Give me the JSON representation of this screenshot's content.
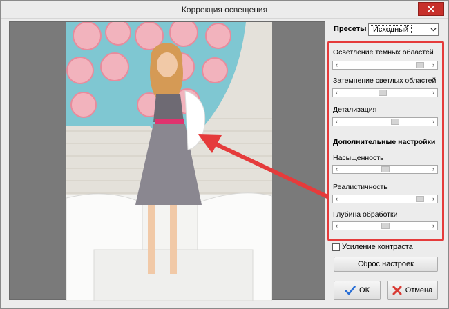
{
  "window": {
    "title": "Коррекция освещения",
    "close_icon": "close-icon"
  },
  "presets": {
    "label": "Пресеты",
    "selected": "Исходный"
  },
  "sliders": [
    {
      "label": "Осветление тёмных областей",
      "value": 0.93
    },
    {
      "label": "Затемнение светлых областей",
      "value": 0.47
    },
    {
      "label": "Детализация",
      "value": 0.62
    }
  ],
  "advanced": {
    "heading": "Дополнительные настройки",
    "sliders": [
      {
        "label": "Насыщенность",
        "value": 0.5
      },
      {
        "label": "Реалистичность",
        "value": 0.93
      },
      {
        "label": "Глубина обработки",
        "value": 0.5
      }
    ]
  },
  "contrast": {
    "label": "Усиление контраста",
    "checked": false
  },
  "buttons": {
    "reset": "Сброс настроек",
    "ok": "ОК",
    "cancel": "Отмена"
  },
  "colors": {
    "highlight": "#e53b3b",
    "close": "#c7302b",
    "preview_bg": "#7a7a7a"
  }
}
